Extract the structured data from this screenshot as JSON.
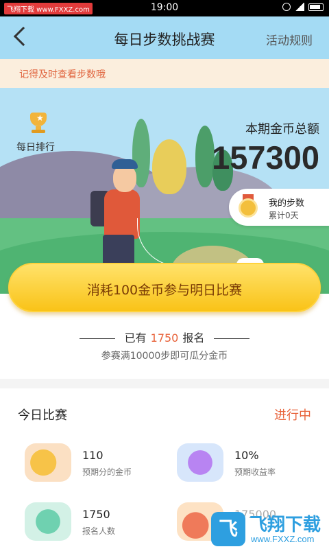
{
  "status_bar": {
    "watermark": "飞翔下载 www.FXXZ.com",
    "time": "19:00"
  },
  "nav": {
    "title": "每日步数挑战赛",
    "rules": "活动规则"
  },
  "tip": "记得及时查看步数哦",
  "hero": {
    "daily_rank": "每日排行",
    "pool_label": "本期金币总额",
    "pool_value": "157300",
    "my_steps_title": "我的步数",
    "my_steps_sub": "累计0天"
  },
  "join": {
    "button": "消耗100金币参与明日比赛",
    "signup_prefix": "已有",
    "signup_count": "1750",
    "signup_suffix": "报名",
    "rule": "参赛满10000步即可瓜分金币"
  },
  "today": {
    "title": "今日比赛",
    "status": "进行中",
    "stats": [
      {
        "value": "110",
        "label": "预期分的金币",
        "icon": "coins-icon"
      },
      {
        "value": "10%",
        "label": "预期收益率",
        "icon": "chart-icon"
      },
      {
        "value": "1750",
        "label": "报名人数",
        "icon": "people-icon"
      },
      {
        "value": "175000",
        "label": "",
        "icon": "moneybag-icon"
      }
    ]
  },
  "bottom_watermark": {
    "logo": "飞",
    "title": "飞翔下载",
    "url": "www.FXXZ.com"
  },
  "colors": {
    "accent": "#e8633b",
    "nav_bg": "#a4dbf4",
    "button_yellow": "#f9c318",
    "watermark_blue": "#2e9fe0"
  }
}
